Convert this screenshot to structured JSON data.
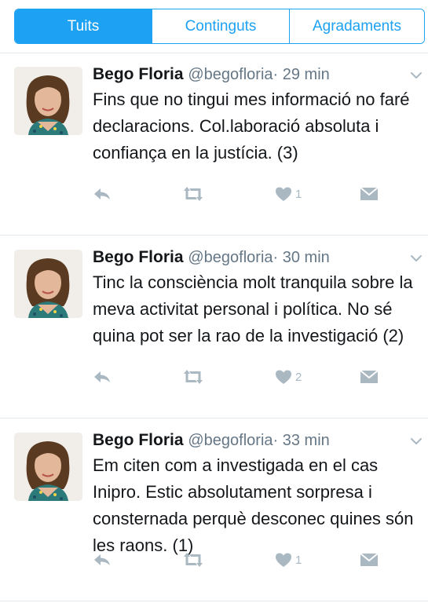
{
  "tabs": [
    {
      "label": "Tuits",
      "active": true
    },
    {
      "label": "Continguts",
      "active": false
    },
    {
      "label": "Agradaments",
      "active": false
    }
  ],
  "colors": {
    "accent": "#1da1f2",
    "action_icon": "#aab8c2",
    "meta_text": "#657786",
    "divider": "#e1e8ed"
  },
  "icons": {
    "reply": "reply-arrow-icon",
    "retweet": "retweet-icon",
    "like": "heart-icon",
    "message": "direct-message-icon",
    "menu": "chevron-down-icon"
  },
  "tweets": [
    {
      "author": "Bego Floria",
      "handle": "@begofloria",
      "time": "· 29 min",
      "text": "Fins que no tingui mes informació no faré declaracions. Col.laboració absoluta i confiança en la justícia. (3)",
      "likes": "1"
    },
    {
      "author": "Bego Floria",
      "handle": "@begofloria",
      "time": "· 30 min",
      "text": "Tinc la consciència molt tranquila sobre la meva activitat personal i política. No sé quina pot ser la rao de la investigació (2)",
      "likes": "2"
    },
    {
      "author": "Bego Floria",
      "handle": "@begofloria",
      "time": "· 33 min",
      "text": "Em citen com a investigada en el cas Inipro. Estic absolutament sorpresa i consternada perquè desconec quines són les raons. (1)",
      "likes": "1"
    }
  ]
}
